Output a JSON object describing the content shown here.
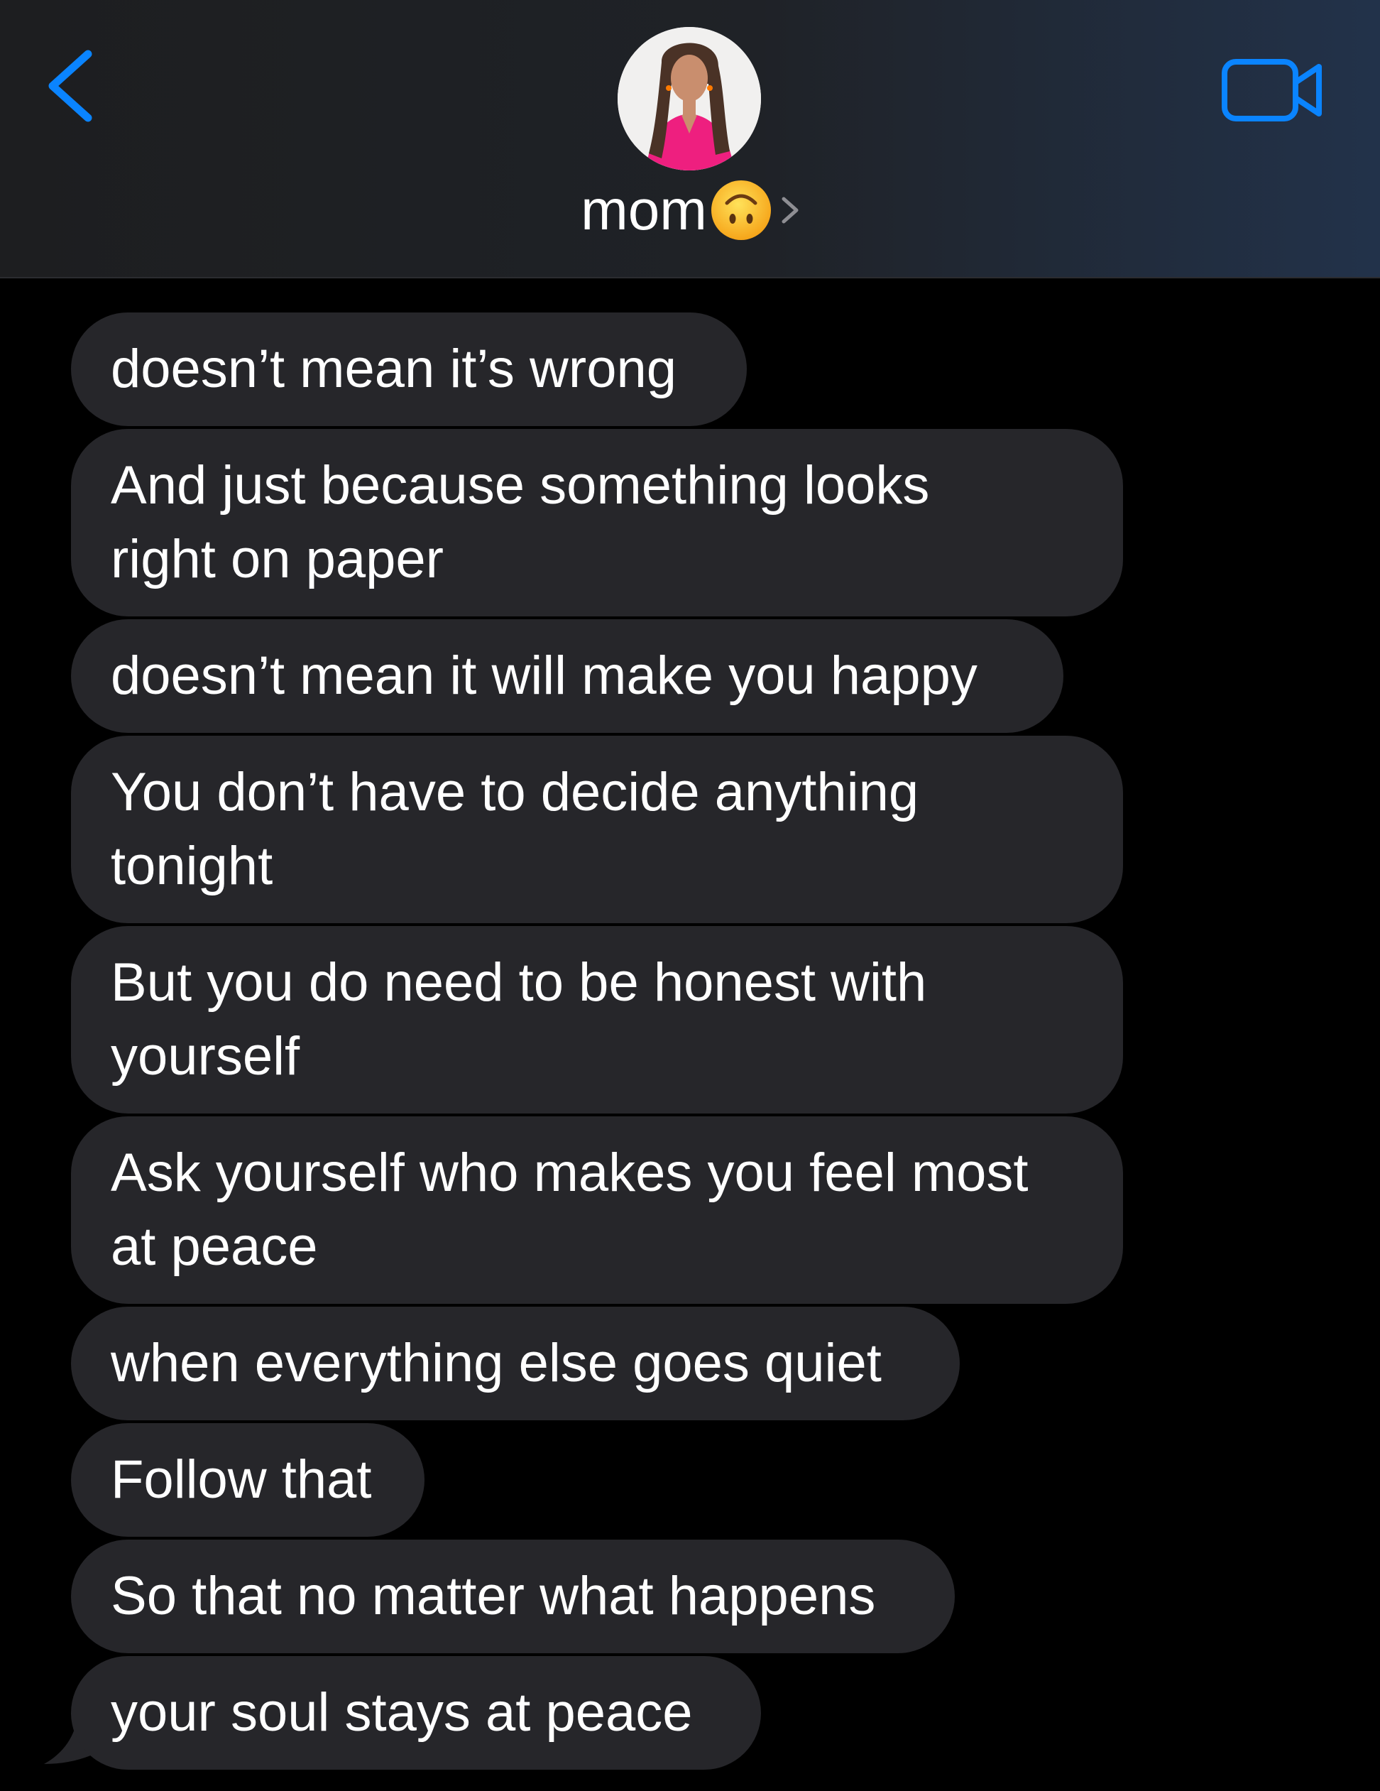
{
  "header": {
    "contact_name": "mom",
    "contact_emoji": "upside-down-face-emoji",
    "back_icon": "chevron-left-icon",
    "video_icon": "video-camera-icon",
    "chevron_icon": "chevron-right-icon",
    "accent_color": "#0a84ff"
  },
  "messages": [
    {
      "lines": [
        "doesn’t mean it’s wrong"
      ]
    },
    {
      "lines": [
        "And just because something looks",
        "right on paper"
      ]
    },
    {
      "lines": [
        "doesn’t mean it will make you happy"
      ]
    },
    {
      "lines": [
        "You don’t have to decide anything",
        "tonight"
      ]
    },
    {
      "lines": [
        "But you do need to be honest with",
        "yourself"
      ]
    },
    {
      "lines": [
        "Ask yourself who makes you feel most",
        "at peace"
      ]
    },
    {
      "lines": [
        "when everything else goes quiet"
      ]
    },
    {
      "lines": [
        "Follow that"
      ]
    },
    {
      "lines": [
        "So that no matter what happens"
      ]
    },
    {
      "lines": [
        "your soul stays at peace"
      ]
    }
  ],
  "colors": {
    "background": "#000000",
    "incoming_bubble": "#26262a",
    "text": "#ffffff"
  }
}
